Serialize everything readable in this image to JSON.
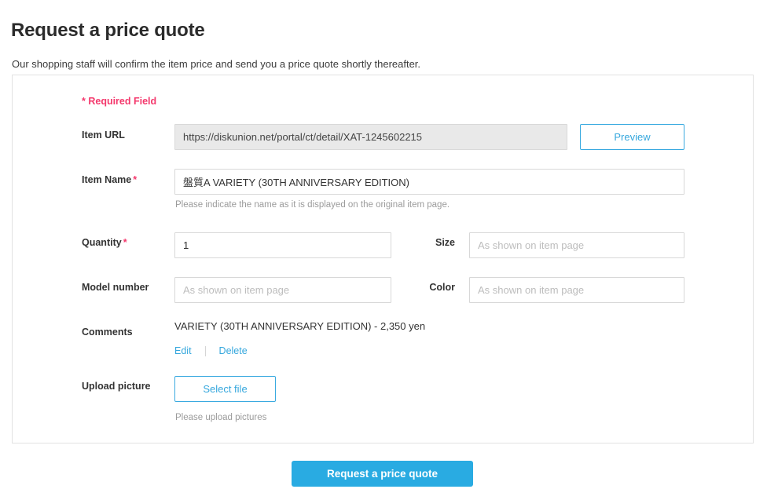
{
  "header": {
    "title": "Request a price quote",
    "subtitle": "Our shopping staff will confirm the item price and send you a price quote shortly thereafter."
  },
  "form": {
    "required_note": "* Required Field",
    "required_marker": "*",
    "fields": {
      "item_url": {
        "label": "Item URL",
        "value": "https://diskunion.net/portal/ct/detail/XAT-1245602215",
        "preview_button": "Preview"
      },
      "item_name": {
        "label": "Item Name",
        "value": "盤質A VARIETY (30TH ANNIVERSARY EDITION)",
        "helper": "Please indicate the name as it is displayed on the original item page."
      },
      "quantity": {
        "label": "Quantity",
        "value": "1"
      },
      "size": {
        "label": "Size",
        "placeholder": "As shown on item page"
      },
      "model_number": {
        "label": "Model number",
        "placeholder": "As shown on item page"
      },
      "color": {
        "label": "Color",
        "placeholder": "As shown on item page"
      },
      "comments": {
        "label": "Comments",
        "text": "VARIETY (30TH ANNIVERSARY EDITION) - 2,350 yen",
        "edit_link": "Edit",
        "delete_link": "Delete"
      },
      "upload_picture": {
        "label": "Upload picture",
        "select_button": "Select file",
        "helper": "Please upload pictures"
      }
    }
  },
  "submit": {
    "label": "Request a price quote"
  },
  "colors": {
    "accent_blue": "#29abe2",
    "required_pink": "#f4386c",
    "link_blue": "#35a7dd",
    "readonly_bg": "#e9e9e9"
  }
}
